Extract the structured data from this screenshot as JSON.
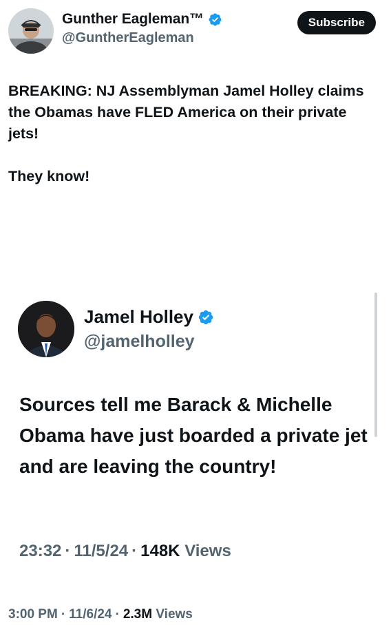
{
  "post": {
    "author_name": "Gunther Eagleman™",
    "author_handle": "@GuntherEagleman",
    "subscribe_label": "Subscribe",
    "text_line1": "BREAKING: NJ Assemblyman Jamel Holley claims the Obamas have FLED America on their private jets!",
    "text_line2": "They know!",
    "time": "3:00 PM",
    "date": "11/6/24",
    "views_count": "2.3M",
    "views_label": "Views"
  },
  "embedded_post": {
    "author_name": "Jamel Holley",
    "author_handle": "@jamelholley",
    "text": "Sources tell me Barack & Michelle Obama have just boarded a private jet and are leaving the country!",
    "time": "23:32",
    "date": "11/5/24",
    "views_count": "148K",
    "views_label": "Views"
  },
  "colors": {
    "verified_blue": "#1d9bf0",
    "text_primary": "#0f1419",
    "text_secondary": "#536471",
    "button_bg": "#0f1419"
  },
  "icons": {
    "verified": "verified-badge-icon",
    "avatar_main": "avatar",
    "avatar_embedded": "avatar"
  }
}
